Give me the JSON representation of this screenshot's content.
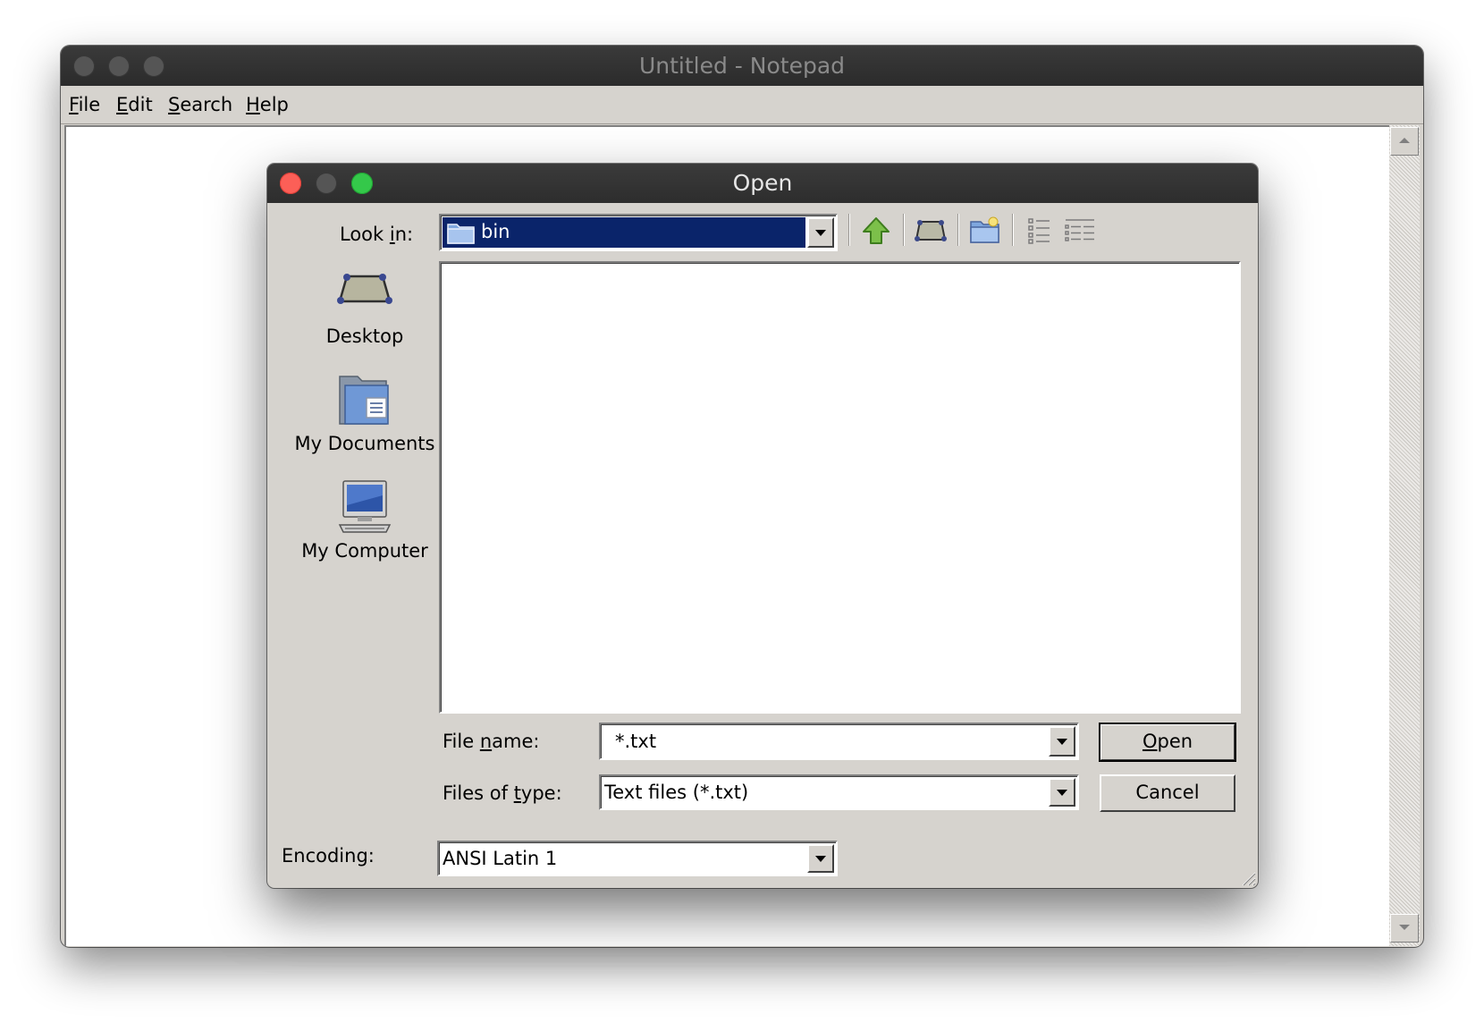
{
  "window": {
    "title": "Untitled - Notepad"
  },
  "menu": {
    "file": {
      "label": "File",
      "accel": "F",
      "rest": "ile"
    },
    "edit": {
      "label": "Edit",
      "accel": "E",
      "rest": "dit"
    },
    "search": {
      "label": "Search",
      "accel": "S",
      "rest": "earch"
    },
    "help": {
      "label": "Help",
      "accel": "H",
      "rest": "elp"
    }
  },
  "dialog": {
    "title": "Open",
    "look_in": {
      "label_pre": "Look ",
      "label_accel": "i",
      "label_post": "n:",
      "value": "bin"
    },
    "toolbar": {
      "up": "up-folder-icon",
      "desktop": "desktop-icon",
      "new_folder": "new-folder-icon",
      "list": "list-view-icon",
      "details": "details-view-icon"
    },
    "places": [
      {
        "label": "Desktop",
        "icon": "desktop-icon"
      },
      {
        "label": "My Documents",
        "icon": "documents-folder-icon"
      },
      {
        "label": "My Computer",
        "icon": "computer-icon"
      }
    ],
    "file_name": {
      "label_pre": "File ",
      "label_accel": "n",
      "label_post": "ame:",
      "value": "*.txt"
    },
    "files_of_type": {
      "label_pre": "Files of ",
      "label_accel": "t",
      "label_post": "ype:",
      "value": "Text files (*.txt)"
    },
    "encoding": {
      "label": "Encoding:",
      "value": "ANSI Latin 1"
    },
    "open_button": {
      "accel": "O",
      "rest": "pen"
    },
    "cancel_button": "Cancel"
  },
  "colors": {
    "selection": "#0a246a",
    "chrome": "#d6d3ce",
    "close": "#fc5f57",
    "zoom": "#34c84a"
  }
}
